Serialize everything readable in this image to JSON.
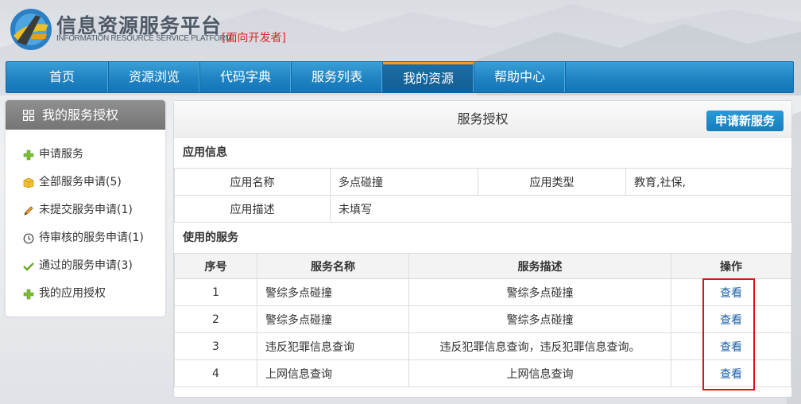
{
  "header": {
    "title_cn": "信息资源服务平台",
    "title_en": "INFORMATION RESOURCE SERVICE PLATFORM",
    "developer_tag": "[面向开发者]"
  },
  "nav": {
    "items": [
      {
        "label": "首页"
      },
      {
        "label": "资源浏览"
      },
      {
        "label": "代码字典"
      },
      {
        "label": "服务列表"
      },
      {
        "label": "我的资源"
      },
      {
        "label": "帮助中心"
      }
    ],
    "active_index": 4,
    "accent_color": "#f29a1c"
  },
  "sidebar": {
    "title": "我的服务授权",
    "items": [
      {
        "label": "申请服务",
        "icon": "plus-icon"
      },
      {
        "label": "全部服务申请(5)",
        "icon": "box-icon"
      },
      {
        "label": "未提交服务申请(1)",
        "icon": "pencil-icon"
      },
      {
        "label": "待审核的服务申请(1)",
        "icon": "clock-icon"
      },
      {
        "label": "通过的服务申请(3)",
        "icon": "check-icon"
      },
      {
        "label": "我的应用授权",
        "icon": "plus-icon"
      }
    ]
  },
  "panel": {
    "title": "服务授权",
    "apply_button": "申请新服务",
    "app_info": {
      "section_title": "应用信息",
      "name_label": "应用名称",
      "name_value": "多点碰撞",
      "type_label": "应用类型",
      "type_value": "教育,社保,",
      "desc_label": "应用描述",
      "desc_value": "未填写"
    },
    "services": {
      "section_title": "使用的服务",
      "columns": [
        "序号",
        "服务名称",
        "服务描述",
        "操作"
      ],
      "rows": [
        {
          "no": "1",
          "name": "警综多点碰撞",
          "desc": "警综多点碰撞",
          "action": "查看"
        },
        {
          "no": "2",
          "name": "警综多点碰撞",
          "desc": "警综多点碰撞",
          "action": "查看"
        },
        {
          "no": "3",
          "name": "违反犯罪信息查询",
          "desc": "违反犯罪信息查询，违反犯罪信息查询。",
          "action": "查看"
        },
        {
          "no": "4",
          "name": "上网信息查询",
          "desc": "上网信息查询",
          "action": "查看"
        }
      ]
    }
  }
}
